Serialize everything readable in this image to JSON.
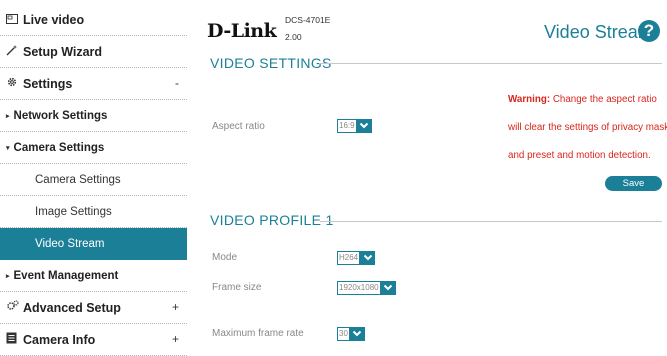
{
  "sidebar": {
    "items": [
      {
        "label": "Live video"
      },
      {
        "label": "Setup Wizard"
      },
      {
        "label": "Settings",
        "sign": "-"
      },
      {
        "label": "Network Settings"
      },
      {
        "label": "Camera Settings"
      },
      {
        "label": "Camera Settings"
      },
      {
        "label": "Image Settings"
      },
      {
        "label": "Video Stream"
      },
      {
        "label": "Event Management"
      },
      {
        "label": "Advanced Setup",
        "sign": "+"
      },
      {
        "label": "Camera Info",
        "sign": "+"
      }
    ]
  },
  "header": {
    "logo": "D-Link",
    "model": "DCS-4701E",
    "version": "2.00",
    "title": "Video Stream",
    "help": "?"
  },
  "video_settings": {
    "title": "VIDEO SETTINGS",
    "aspect_label": "Aspect ratio",
    "aspect_value": "16:9",
    "warning_label": "Warning:",
    "warning_line1": " Change the aspect ratio",
    "warning_line2": "will clear the settings of privacy mask",
    "warning_line3": "and preset and motion detection.",
    "save_label": "Save"
  },
  "video_profile": {
    "title": "VIDEO PROFILE 1",
    "mode_label": "Mode",
    "mode_value": "H264",
    "frame_size_label": "Frame size",
    "frame_size_value": "1920x1080",
    "max_rate_label": "Maximum frame rate",
    "max_rate_value": "30"
  },
  "colors": {
    "accent": "#1b7f97",
    "warning": "#d9261c"
  }
}
